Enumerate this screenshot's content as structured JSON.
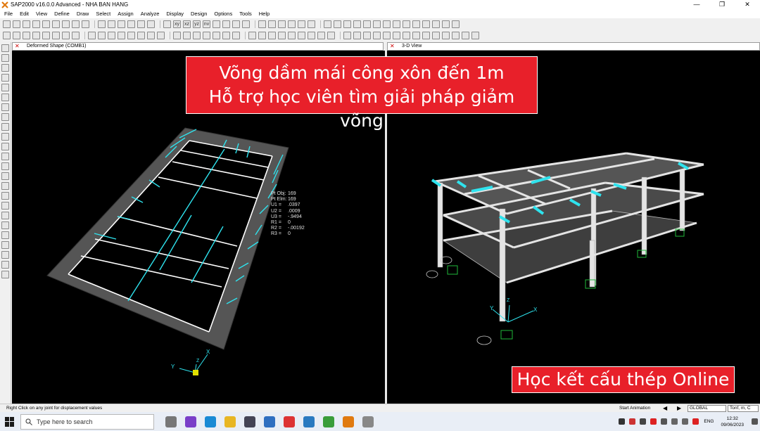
{
  "window": {
    "title": "SAP2000 v16.0.0 Advanced  - NHA BAN HANG",
    "controls": [
      "—",
      "❐",
      "✕"
    ]
  },
  "menu": [
    "File",
    "Edit",
    "View",
    "Define",
    "Draw",
    "Select",
    "Assign",
    "Analyze",
    "Display",
    "Design",
    "Options",
    "Tools",
    "Help"
  ],
  "toolbar_text": {
    "view_xy": "xy",
    "view_xz": "xz",
    "view_yz": "yz",
    "view_nv": "nv"
  },
  "tabs": {
    "left": "Deformed Shape (COMB1)",
    "right": "3-D View"
  },
  "annotations": {
    "top_line1": "Võng dầm mái công xôn đến 1m",
    "top_line2": "Hỗ trợ học viên tìm giải pháp giảm võng",
    "bottom": "Học kết cấu thép Online"
  },
  "joint_popup": [
    {
      "k": "Pt Obj:",
      "v": "169"
    },
    {
      "k": "Pt Elm:",
      "v": "169"
    },
    {
      "k": "U1 =",
      "v": ".0397"
    },
    {
      "k": "U2 =",
      "v": ".0009"
    },
    {
      "k": "U3 =",
      "v": "-.9494"
    },
    {
      "k": "R1 =",
      "v": "0"
    },
    {
      "k": "R2 =",
      "v": "-.00192"
    },
    {
      "k": "R3 =",
      "v": "0"
    }
  ],
  "axes_labels": {
    "x": "X",
    "y": "Y",
    "z": "Z"
  },
  "status": {
    "hint": "Right Click on any joint for displacement values",
    "start_animation": "Start Animation",
    "coord_system": "GLOBAL",
    "units": "Tonf, m, C"
  },
  "taskbar": {
    "search_placeholder": "Type here to search",
    "lang": "ENG",
    "time": "12:32",
    "date": "09/06/2023"
  },
  "colors": {
    "banner": "#e8202a",
    "beam_deformed": "#2ee3ee",
    "frame": "#ffffff",
    "slab": "#4a4a4a",
    "support": "#1fb83a"
  }
}
